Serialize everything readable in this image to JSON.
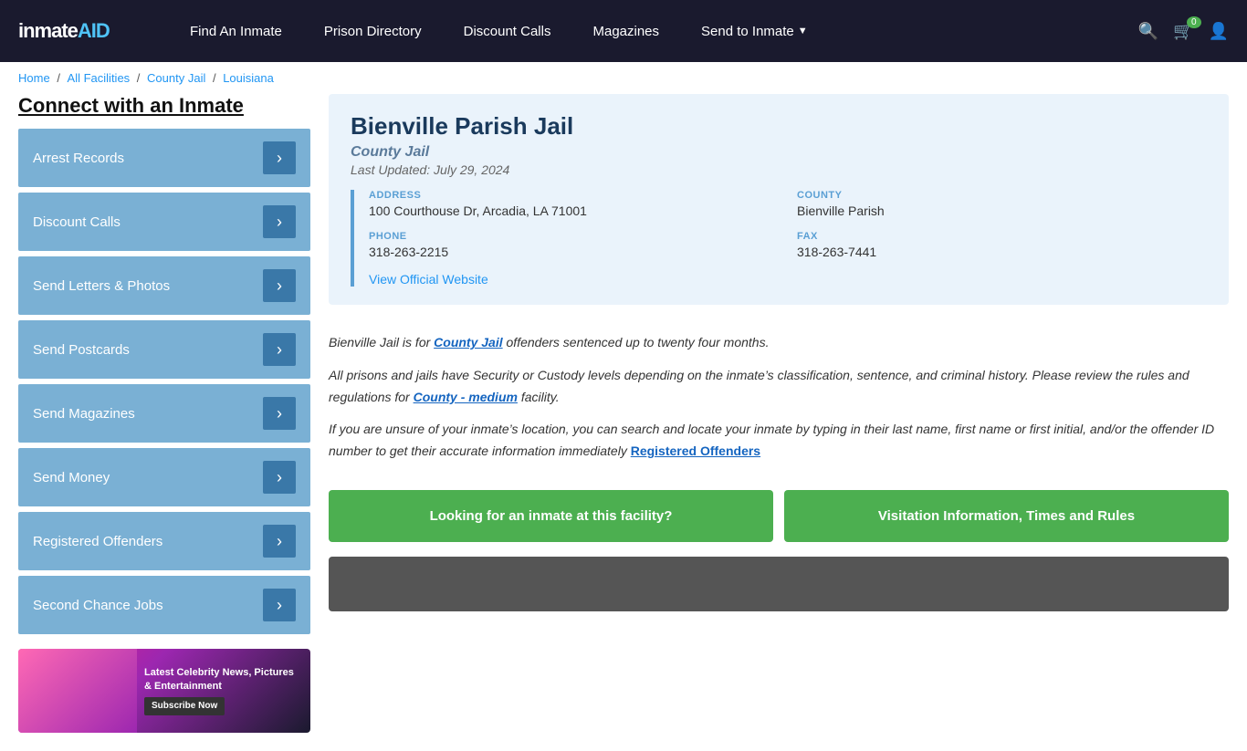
{
  "header": {
    "logo": "inmateAID",
    "logo_highlight": "AID",
    "nav": [
      {
        "label": "Find An Inmate",
        "id": "find-inmate"
      },
      {
        "label": "Prison Directory",
        "id": "prison-directory"
      },
      {
        "label": "Discount Calls",
        "id": "discount-calls"
      },
      {
        "label": "Magazines",
        "id": "magazines"
      },
      {
        "label": "Send to Inmate",
        "id": "send-to-inmate",
        "dropdown": true
      }
    ],
    "cart_count": "0",
    "icons": [
      "search",
      "cart",
      "user"
    ]
  },
  "breadcrumb": {
    "items": [
      "Home",
      "All Facilities",
      "County Jail",
      "Louisiana"
    ],
    "separator": "/"
  },
  "sidebar": {
    "title": "Connect with an Inmate",
    "menu": [
      {
        "label": "Arrest Records"
      },
      {
        "label": "Discount Calls"
      },
      {
        "label": "Send Letters & Photos"
      },
      {
        "label": "Send Postcards"
      },
      {
        "label": "Send Magazines"
      },
      {
        "label": "Send Money"
      },
      {
        "label": "Registered Offenders"
      },
      {
        "label": "Second Chance Jobs"
      }
    ],
    "ad": {
      "text": "Latest Celebrity News, Pictures & Entertainment",
      "subscribe": "Subscribe Now"
    }
  },
  "facility": {
    "name": "Bienville Parish Jail",
    "type": "County Jail",
    "last_updated": "Last Updated: July 29, 2024",
    "address_label": "ADDRESS",
    "address": "100 Courthouse Dr, Arcadia, LA 71001",
    "county_label": "COUNTY",
    "county": "Bienville Parish",
    "phone_label": "PHONE",
    "phone": "318-263-2215",
    "fax_label": "FAX",
    "fax": "318-263-7441",
    "website_link": "View Official Website"
  },
  "description": {
    "para1_before": "Bienville Jail is for ",
    "para1_link": "County Jail",
    "para1_after": " offenders sentenced up to twenty four months.",
    "para2_before": "All prisons and jails have Security or Custody levels depending on the inmate’s classification, sentence, and criminal history. Please review the rules and regulations for ",
    "para2_link": "County - medium",
    "para2_after": " facility.",
    "para3_before": "If you are unsure of your inmate’s location, you can search and locate your inmate by typing in their last name, first name or first initial, and/or the offender ID number to get their accurate information immediately ",
    "para3_link": "Registered Offenders"
  },
  "cta": {
    "btn1": "Looking for an inmate at this facility?",
    "btn2": "Visitation Information, Times and Rules"
  }
}
